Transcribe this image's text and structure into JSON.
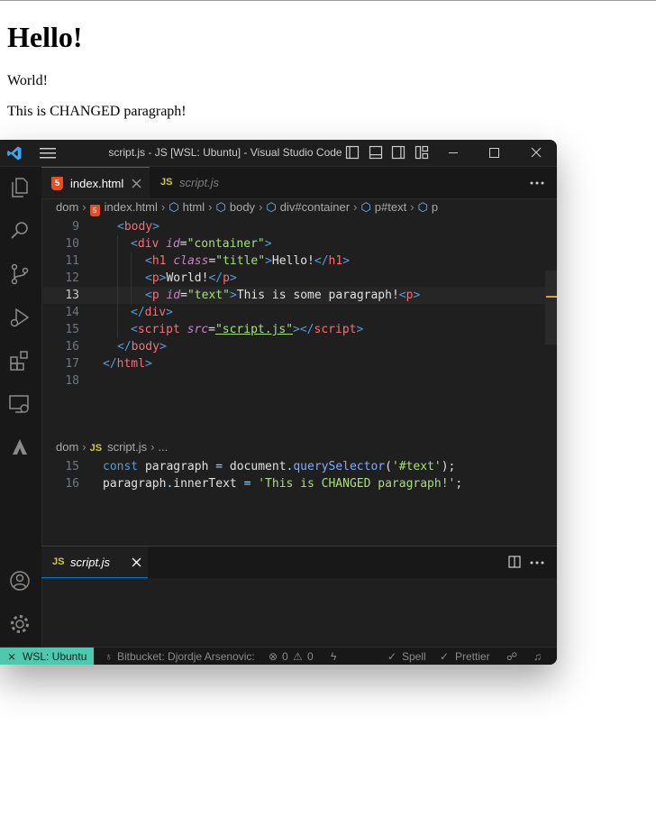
{
  "page": {
    "heading": "Hello!",
    "para1": "World!",
    "para2": "This is CHANGED paragraph!"
  },
  "window": {
    "title": "script.js - JS [WSL: Ubuntu] - Visual Studio Code"
  },
  "editor_top": {
    "tabs": [
      {
        "icon": "5",
        "label": "index.html",
        "active": true
      },
      {
        "icon": "JS",
        "label": "script.js",
        "active": false
      }
    ],
    "breadcrumb": [
      "dom",
      "index.html",
      "html",
      "body",
      "div#container",
      "p#text",
      "p"
    ],
    "lines": [
      {
        "n": "9"
      },
      {
        "n": "10"
      },
      {
        "n": "11"
      },
      {
        "n": "12"
      },
      {
        "n": "13"
      },
      {
        "n": "14"
      },
      {
        "n": "15"
      },
      {
        "n": "16"
      },
      {
        "n": "17"
      },
      {
        "n": "18"
      }
    ]
  },
  "editor_bottom": {
    "tab_icon": "JS",
    "tab_label": "script.js",
    "breadcrumb": [
      "dom",
      "script.js",
      "..."
    ],
    "lines": [
      {
        "n": "15"
      },
      {
        "n": "16"
      }
    ]
  },
  "statusbar": {
    "remote": "WSL: Ubuntu",
    "bitbucket": "Bitbucket: Djordje Arsenovic:",
    "errors": "0",
    "warnings": "0",
    "spell": "Spell",
    "prettier": "Prettier"
  },
  "colors": {
    "accent": "#0078d4",
    "remote_bg": "#4ec9b0",
    "editor_bg": "#1f1f1f"
  }
}
